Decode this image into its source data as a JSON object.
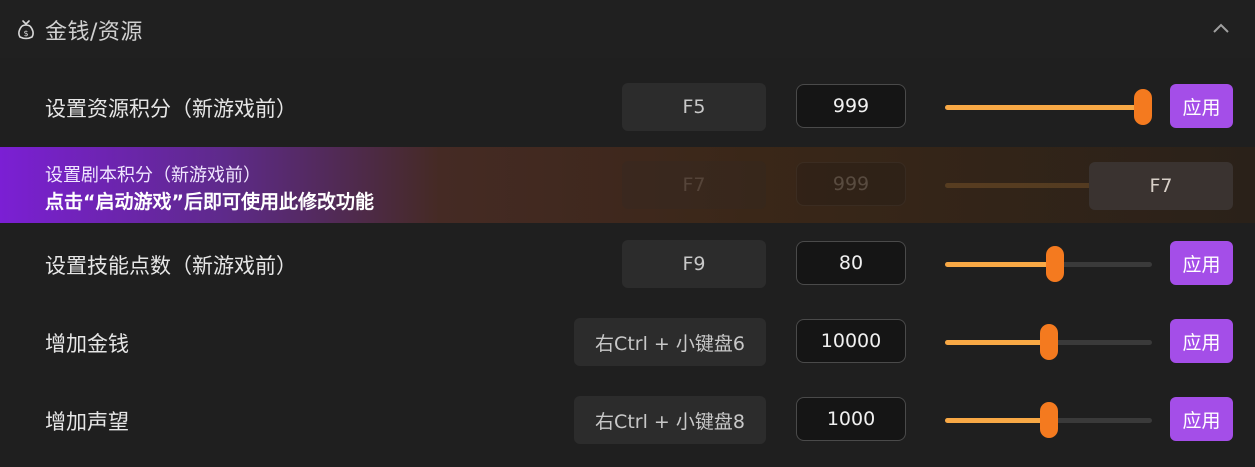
{
  "section": {
    "title": "金钱/资源",
    "icon": "money-bag-icon",
    "collapse_icon": "chevron-up-icon"
  },
  "colors": {
    "accent_orange": "#f47a1f",
    "slider_fill": "#f8a845",
    "apply_purple": "#a44ee8",
    "disabled_gradient_start": "#7b1fd4"
  },
  "rows": [
    {
      "label": "设置资源积分（新游戏前）",
      "hotkey": "F5",
      "value": "999",
      "slider_fraction": 1.0,
      "apply_label": "应用"
    },
    {
      "label": "设置剧本积分（新游戏前）",
      "hotkey": "F7",
      "value": "999",
      "slider_fraction": 1.0,
      "disabled": true,
      "hint": "点击“启动游戏”后即可使用此修改功能",
      "hotkey_box": "F7"
    },
    {
      "label": "设置技能点数（新游戏前）",
      "hotkey": "F9",
      "value": "80",
      "slider_fraction": 0.53,
      "apply_label": "应用"
    },
    {
      "label": "增加金钱",
      "hotkey": "右Ctrl + 小键盘6",
      "value": "10000",
      "slider_fraction": 0.5,
      "apply_label": "应用"
    },
    {
      "label": "增加声望",
      "hotkey": "右Ctrl + 小键盘8",
      "value": "1000",
      "slider_fraction": 0.5,
      "apply_label": "应用"
    }
  ]
}
